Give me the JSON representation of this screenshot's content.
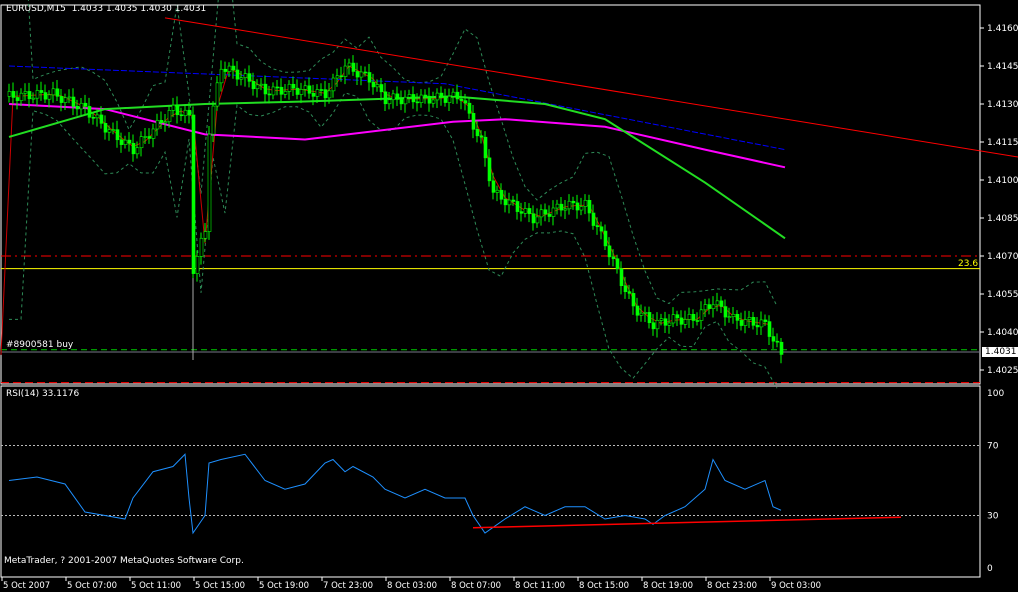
{
  "header": {
    "symbol": "EURUSD,M15",
    "open": "1.4033",
    "high": "1.4035",
    "low": "1.4030",
    "close": "1.4031"
  },
  "rsi_label": "RSI(14) 33.1176",
  "copyright": "MetaTrader, ? 2001-2007 MetaQuotes Software Corp.",
  "order_label": "#8900581 buy",
  "fib_label": "23.6",
  "current_price": "1.4031",
  "colors": {
    "bull": "#00ff00",
    "trend": "#ff0000",
    "ma_blue": "#0000ff",
    "ma_magenta": "#ff00ff",
    "ma_green": "#00cc00",
    "rsi": "#1e90ff",
    "fib": "#ffff00"
  },
  "chart_data": [
    {
      "type": "line",
      "title": "EURUSD,M15",
      "ylim": [
        1.4018,
        1.4176
      ],
      "y_ticks": [
        "1.4160",
        "1.4145",
        "1.4130",
        "1.4115",
        "1.4100",
        "1.4085",
        "1.4070",
        "1.4055",
        "1.4040",
        "1.4025"
      ],
      "x_ticks": [
        "5 Oct 2007",
        "5 Oct 07:00",
        "5 Oct 11:00",
        "5 Oct 15:00",
        "5 Oct 19:00",
        "7 Oct 23:00",
        "8 Oct 03:00",
        "8 Oct 07:00",
        "8 Oct 11:00",
        "8 Oct 15:00",
        "8 Oct 19:00",
        "8 Oct 23:00",
        "9 Oct 03:00"
      ],
      "bars_per_tick": 16,
      "close_series": [
        [
          1,
          1.4133
        ],
        [
          12,
          1.4134
        ],
        [
          20,
          1.4128
        ],
        [
          27,
          1.4118
        ],
        [
          32,
          1.4112
        ],
        [
          37,
          1.412
        ],
        [
          42,
          1.4128
        ],
        [
          46,
          1.4125
        ],
        [
          47,
          1.4065
        ],
        [
          50,
          1.408
        ],
        [
          51,
          1.412
        ],
        [
          54,
          1.4145
        ],
        [
          60,
          1.414
        ],
        [
          65,
          1.4135
        ],
        [
          72,
          1.4136
        ],
        [
          80,
          1.4134
        ],
        [
          85,
          1.4145
        ],
        [
          91,
          1.414
        ],
        [
          95,
          1.4132
        ],
        [
          105,
          1.4132
        ],
        [
          114,
          1.4133
        ],
        [
          116,
          1.4125
        ],
        [
          119,
          1.4115
        ],
        [
          122,
          1.4095
        ],
        [
          127,
          1.409
        ],
        [
          132,
          1.4085
        ],
        [
          140,
          1.409
        ],
        [
          145,
          1.409
        ],
        [
          150,
          1.4075
        ],
        [
          154,
          1.406
        ],
        [
          157,
          1.405
        ],
        [
          162,
          1.4043
        ],
        [
          167,
          1.4045
        ],
        [
          172,
          1.4045
        ],
        [
          177,
          1.4052
        ],
        [
          182,
          1.4045
        ],
        [
          190,
          1.4043
        ],
        [
          194,
          1.4031
        ]
      ],
      "ma_blue": [
        [
          1,
          1.4145
        ],
        [
          110,
          1.4138
        ],
        [
          195,
          1.4112
        ]
      ],
      "ma_magenta": [
        [
          1,
          1.413
        ],
        [
          25,
          1.4128
        ],
        [
          50,
          1.4118
        ],
        [
          75,
          1.4116
        ],
        [
          112,
          1.4123
        ],
        [
          125,
          1.4124
        ],
        [
          150,
          1.4121
        ],
        [
          175,
          1.4112
        ],
        [
          195,
          1.4105
        ]
      ],
      "ma_green": [
        [
          1,
          1.4117
        ],
        [
          25,
          1.4128
        ],
        [
          50,
          1.413
        ],
        [
          75,
          1.4131
        ],
        [
          112,
          1.4133
        ],
        [
          135,
          1.413
        ],
        [
          150,
          1.4124
        ],
        [
          175,
          1.4099
        ],
        [
          195,
          1.4077
        ]
      ],
      "trendline": [
        [
          40,
          1.4164
        ],
        [
          254,
          1.4109
        ]
      ],
      "hlines": {
        "fib_23_6": 1.4065,
        "resistance": 1.407,
        "order_buy": 1.4033,
        "stop": 1.402
      },
      "legend": "none"
    },
    {
      "type": "line",
      "title": "RSI(14) 33.1176",
      "ylim": [
        0,
        100
      ],
      "y_ticks": [
        "100",
        "70",
        "30",
        "0"
      ],
      "levels": [
        70,
        30
      ],
      "series": [
        [
          1,
          50
        ],
        [
          8,
          52
        ],
        [
          15,
          48
        ],
        [
          20,
          32
        ],
        [
          25,
          30
        ],
        [
          30,
          28
        ],
        [
          32,
          40
        ],
        [
          37,
          55
        ],
        [
          42,
          58
        ],
        [
          45,
          65
        ],
        [
          46,
          40
        ],
        [
          47,
          20
        ],
        [
          50,
          30
        ],
        [
          51,
          60
        ],
        [
          54,
          62
        ],
        [
          60,
          65
        ],
        [
          65,
          50
        ],
        [
          70,
          45
        ],
        [
          75,
          48
        ],
        [
          80,
          60
        ],
        [
          82,
          62
        ],
        [
          85,
          55
        ],
        [
          87,
          58
        ],
        [
          92,
          52
        ],
        [
          95,
          45
        ],
        [
          100,
          40
        ],
        [
          105,
          45
        ],
        [
          110,
          40
        ],
        [
          115,
          40
        ],
        [
          117,
          30
        ],
        [
          120,
          20
        ],
        [
          125,
          28
        ],
        [
          130,
          35
        ],
        [
          135,
          30
        ],
        [
          140,
          35
        ],
        [
          145,
          35
        ],
        [
          150,
          28
        ],
        [
          155,
          30
        ],
        [
          160,
          28
        ],
        [
          162,
          25
        ],
        [
          165,
          30
        ],
        [
          170,
          35
        ],
        [
          175,
          45
        ],
        [
          177,
          62
        ],
        [
          180,
          50
        ],
        [
          185,
          45
        ],
        [
          190,
          50
        ],
        [
          192,
          35
        ],
        [
          194,
          33
        ]
      ],
      "trendline": [
        [
          117,
          23
        ],
        [
          224,
          29
        ]
      ]
    }
  ]
}
